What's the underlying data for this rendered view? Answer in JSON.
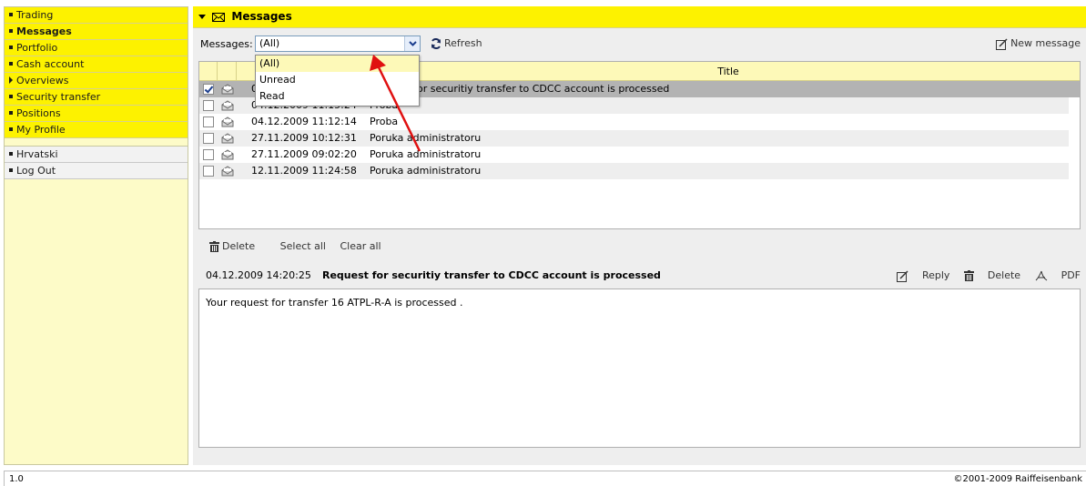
{
  "sidebar": {
    "items": [
      {
        "label": "Trading",
        "marker": "square"
      },
      {
        "label": "Messages",
        "marker": "square"
      },
      {
        "label": "Portfolio",
        "marker": "square"
      },
      {
        "label": "Cash account",
        "marker": "square"
      },
      {
        "label": "Overviews",
        "marker": "triangle"
      },
      {
        "label": "Security transfer",
        "marker": "square"
      },
      {
        "label": "Positions",
        "marker": "square"
      },
      {
        "label": "My Profile",
        "marker": "square"
      }
    ],
    "secondary": [
      {
        "label": "Hrvatski"
      },
      {
        "label": "Log Out"
      }
    ]
  },
  "header": {
    "title": "Messages"
  },
  "toolbar": {
    "filter_label": "Messages:",
    "filter_value": "(All)",
    "refresh_label": "Refresh",
    "new_message_label": "New message"
  },
  "dropdown": {
    "options": [
      "(All)",
      "Unread",
      "Read"
    ]
  },
  "list": {
    "title_header": "Title",
    "rows": [
      {
        "date": "04.12.2009 14:20:25",
        "subject": "Request for securitiy transfer to CDCC account is processed",
        "checked": true,
        "selected": true
      },
      {
        "date": "04.12.2009 11:15:24",
        "subject": "Proba",
        "checked": false
      },
      {
        "date": "04.12.2009 11:12:14",
        "subject": "Proba",
        "checked": false
      },
      {
        "date": "27.11.2009 10:12:31",
        "subject": "Poruka administratoru",
        "checked": false
      },
      {
        "date": "27.11.2009 09:02:20",
        "subject": "Poruka administratoru",
        "checked": false
      },
      {
        "date": "12.11.2009 11:24:58",
        "subject": "Poruka administratoru",
        "checked": false
      }
    ]
  },
  "list_actions": {
    "delete": "Delete",
    "select_all": "Select all",
    "clear_all": "Clear all"
  },
  "detail": {
    "date": "04.12.2009 14:20:25",
    "subject": "Request for securitiy transfer to CDCC account is processed",
    "reply": "Reply",
    "delete": "Delete",
    "pdf": "PDF",
    "body": "Your request for transfer 16 ATPL-R-A is processed ."
  },
  "footer": {
    "version": "1.0",
    "copyright": "©2001-2009 Raiffeisenbank"
  },
  "colors": {
    "accent_yellow": "#fdf200",
    "annotation_red": "#e01010",
    "selected_row": "#b3b3b3"
  }
}
